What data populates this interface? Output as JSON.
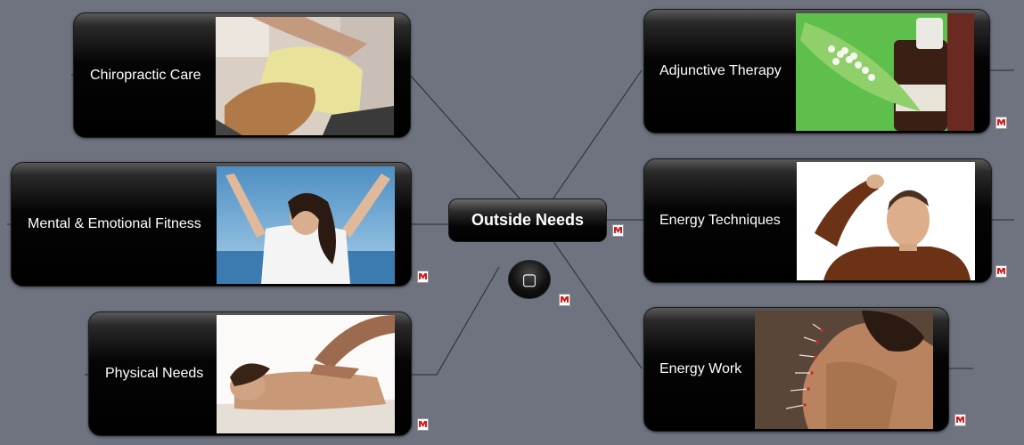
{
  "central_topic": {
    "label": "Outside Needs"
  },
  "small_node": {
    "glyph": "▢"
  },
  "left_topics": [
    {
      "label": "Chiropractic Care",
      "image": "chiropractic-photo"
    },
    {
      "label": "Mental & Emotional Fitness",
      "image": "woman-arms-raised-photo"
    },
    {
      "label": "Physical Needs",
      "image": "massage-photo"
    }
  ],
  "right_topics": [
    {
      "label": "Adjunctive Therapy",
      "image": "homeopathic-pills-photo"
    },
    {
      "label": "Energy Techniques",
      "image": "man-tapping-head-photo"
    },
    {
      "label": "Energy Work",
      "image": "acupuncture-photo"
    }
  ],
  "colors": {
    "background": "#6f7380",
    "node_fill": "#000000",
    "connector": "#2a2a2a",
    "note_icon": "#cc2222"
  },
  "icons": [
    "note-icon"
  ]
}
